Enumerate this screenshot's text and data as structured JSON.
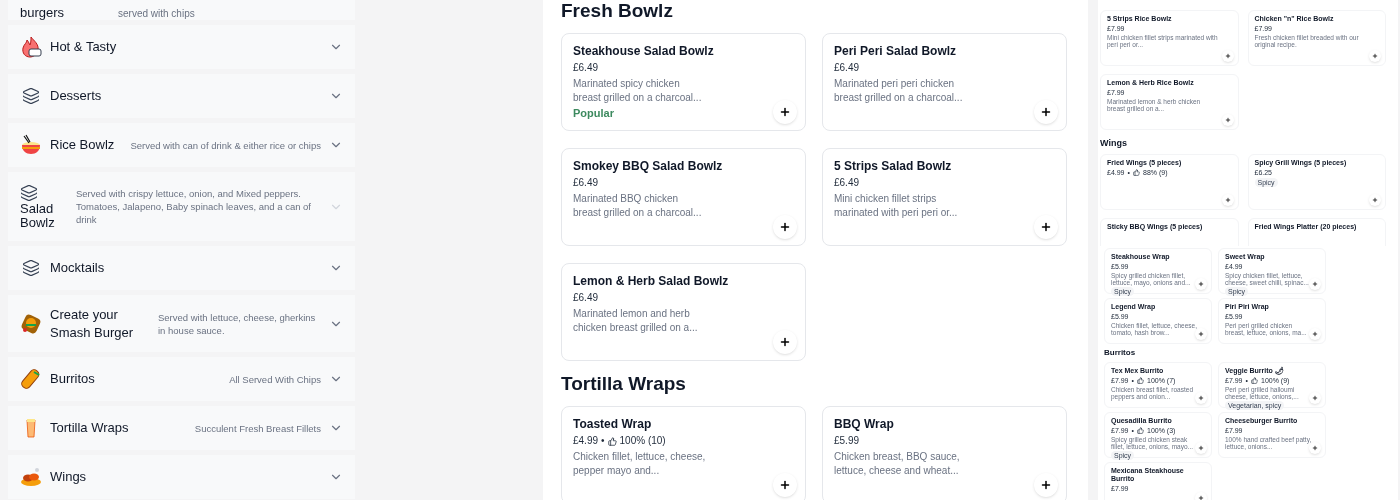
{
  "categories": [
    {
      "name": "burgers",
      "note": "served with chips",
      "kind": "plain"
    },
    {
      "name": "Hot & Tasty",
      "kind": "fire"
    },
    {
      "name": "Desserts",
      "kind": "layers"
    },
    {
      "name": "Rice Bowlz",
      "note": "Served with can of drink & either rice or chips",
      "kind": "rice-bowl"
    },
    {
      "name": "Salad Bowlz",
      "note": "Served with crispy lettuce, onion, and Mixed peppers. Tomatoes, Jalapeno, Baby spinach leaves, and a can of drink",
      "kind": "stacked"
    },
    {
      "name": "Mocktails",
      "kind": "layers"
    },
    {
      "name": "Create your Smash Burger",
      "note": "Served with lettuce, cheese, gherkins in house sauce.",
      "kind": "burger"
    },
    {
      "name": "Burritos",
      "note": "All Served With Chips",
      "kind": "burrito"
    },
    {
      "name": "Tortilla Wraps",
      "note": "Succulent Fresh Breast Fillets",
      "kind": "wrap"
    },
    {
      "name": "Wings",
      "kind": "wings"
    }
  ],
  "menu": [
    {
      "title": "Fresh Bowlz",
      "items": [
        {
          "name": "Steakhouse Salad Bowlz",
          "price": "£6.49",
          "description": "Marinated spicy chicken breast grilled on a charcoal...",
          "tag": {
            "kind": "popular",
            "label": "Popular"
          }
        },
        {
          "name": "Peri Peri Salad Bowlz",
          "price": "£6.49",
          "description": "Marinated peri peri chicken breast grilled on a charcoal..."
        },
        {
          "name": "Smokey BBQ Salad Bowlz",
          "price": "£6.49",
          "description": "Marinated BBQ chicken breast grilled on a charcoal..."
        },
        {
          "name": "5 Strips Salad Bowlz",
          "price": "£6.49",
          "description": "Mini chicken fillet strips marinated with peri peri or..."
        },
        {
          "name": "Lemon & Herb Salad Bowlz",
          "price": "£6.49",
          "description": "Marinated lemon and herb chicken breast grilled on a..."
        }
      ]
    },
    {
      "title": "Tortilla Wraps",
      "items": [
        {
          "name": "Toasted Wrap",
          "price": "£4.99",
          "separator": "•",
          "rating": "100% (10)",
          "description": "Chicken fillet, lettuce, cheese, pepper mayo and..."
        },
        {
          "name": "BBQ Wrap",
          "price": "£5.99",
          "description": "Chicken breast, BBQ sauce, lettuce, cheese and wheat..."
        }
      ]
    }
  ],
  "previews": [
    {
      "kind": "wide",
      "sections": [
        {
          "items": [
            {
              "name": "5 Strips Rice Bowlz",
              "price": "£7.99",
              "description": "Mini chicken fillet strips marinated with peri peri or..."
            },
            {
              "name": "Chicken \"n\" Rice Bowlz",
              "price": "£7.99",
              "description": "Fresh chicken fillet breaded with our original recipe."
            },
            {
              "name": "Lemon & Herb Rice Bowlz",
              "price": "£7.99",
              "description": "Marinated lemon & herb chicken breast grilled on a..."
            }
          ]
        },
        {
          "title": "Wings",
          "items": [
            {
              "name": "Fried Wings (5 pieces)",
              "price": "£4.99",
              "separator": "•",
              "rating": "88% (9)"
            },
            {
              "name": "Spicy Grill Wings (5 pieces)",
              "price": "£6.25",
              "tag": {
                "kind": "pill",
                "label": "Spicy"
              }
            },
            {
              "name": "Sticky BBQ Wings (5 pieces)"
            },
            {
              "name": "Fried Wings Platter (20 pieces)"
            }
          ]
        }
      ]
    },
    {
      "kind": "narrow",
      "sections": [
        {
          "items": [
            {
              "name": "Steakhouse Wrap",
              "price": "£5.99",
              "description": "Spicy grilled chicken fillet, lettuce, mayo, onions and...",
              "tag": {
                "kind": "pill",
                "label": "Spicy"
              }
            },
            {
              "name": "Sweet Wrap",
              "price": "£4.99",
              "description": "Spicy chicken fillet, lettuce, cheese, sweet chilli, spinac...",
              "tag": {
                "kind": "pill",
                "label": "Spicy"
              }
            },
            {
              "name": "Legend Wrap",
              "price": "£5.99",
              "description": "Chicken fillet, lettuce, cheese, tomato, hash brow..."
            },
            {
              "name": "Piri Piri Wrap",
              "price": "£5.99",
              "description": "Peri peri grilled chicken breast, lettuce, onions, ma..."
            }
          ]
        },
        {
          "title": "Burritos",
          "items": [
            {
              "name": "Tex Mex Burrito",
              "price": "£7.99",
              "separator": "•",
              "rating": "100% (7)",
              "description": "Chicken breast fillet, roasted peppers and onion..."
            },
            {
              "name": "Veggie Burrito 🌶",
              "price": "£7.99",
              "separator": "•",
              "rating": "100% (9)",
              "description": "Peri peri grilled halloumi cheese, lettuce, onions,...",
              "tag": {
                "kind": "pill",
                "label": "Vegetarian, spicy"
              }
            },
            {
              "name": "Quesadilla Burrito",
              "price": "£7.99",
              "separator": "•",
              "rating": "100% (3)",
              "description": "Spicy grilled chicken steak fillet, lettuce, onions, mayo...",
              "tag": {
                "kind": "pill",
                "label": "Spicy"
              }
            },
            {
              "name": "Cheeseburger Burrito",
              "price": "£7.99",
              "description": "100% hand crafted beef patty, lettuce, onions..."
            },
            {
              "name": "Mexicana Steakhouse Burrito",
              "price": "£7.99"
            }
          ]
        }
      ]
    }
  ]
}
